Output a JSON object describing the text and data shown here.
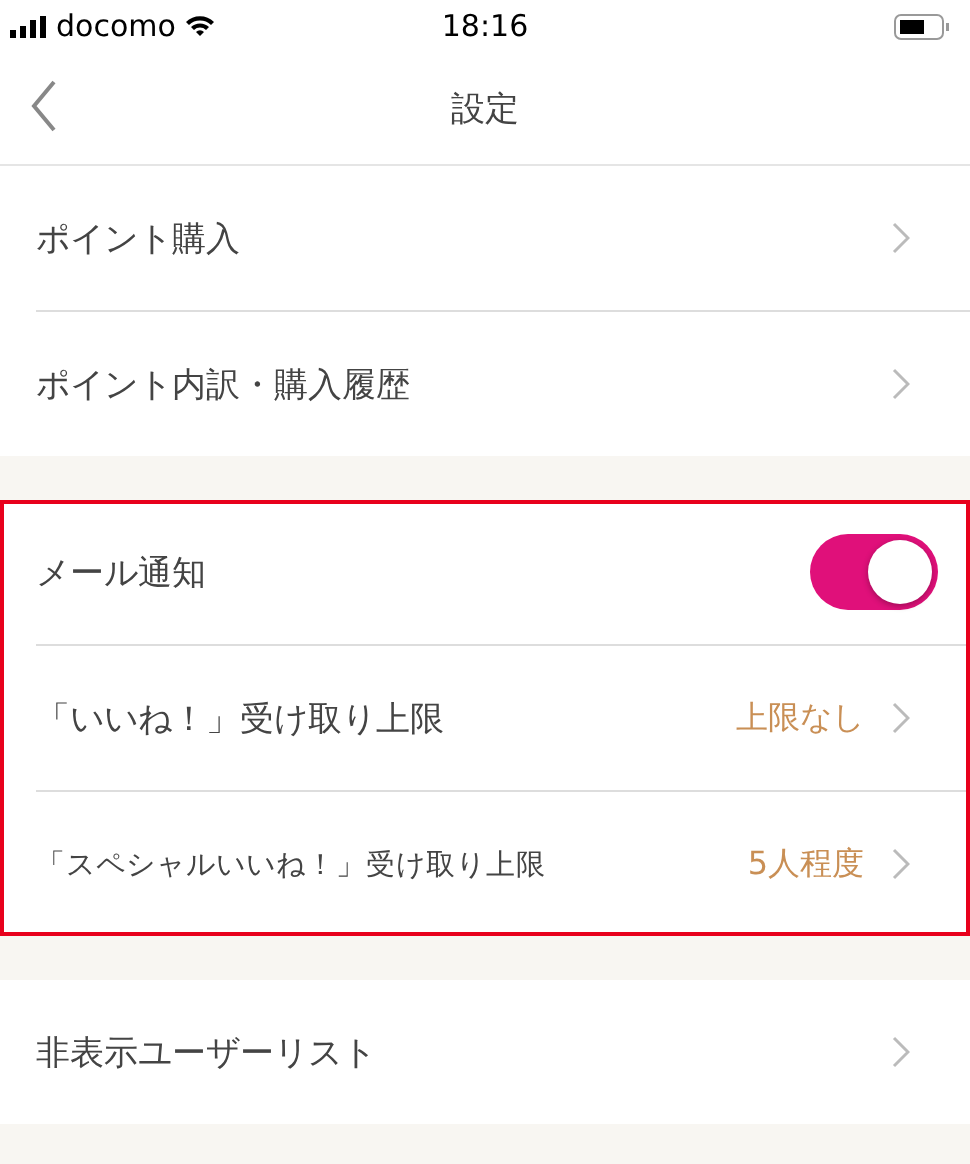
{
  "status_bar": {
    "carrier": "docomo",
    "time": "18:16"
  },
  "nav": {
    "title": "設定"
  },
  "sections": [
    {
      "highlighted": false,
      "items": [
        {
          "kind": "link",
          "label": "ポイント購入"
        },
        {
          "kind": "link",
          "label": "ポイント内訳・購入履歴"
        }
      ]
    },
    {
      "highlighted": true,
      "items": [
        {
          "kind": "toggle",
          "label": "メール通知",
          "on": true
        },
        {
          "kind": "value",
          "label": "「いいね！」受け取り上限",
          "value": "上限なし"
        },
        {
          "kind": "value",
          "label": "「スペシャルいいね！」受け取り上限",
          "value": "5人程度"
        }
      ]
    },
    {
      "highlighted": false,
      "items": [
        {
          "kind": "link",
          "label": "非表示ユーザーリスト"
        }
      ]
    }
  ]
}
